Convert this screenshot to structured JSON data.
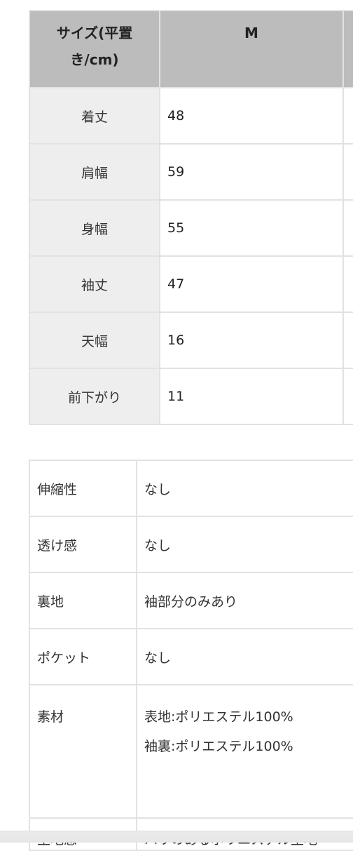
{
  "size_table": {
    "header": {
      "label": "サイズ(平置き/cm)",
      "label_line1": "サイズ(平置",
      "label_line2": "き/cm)",
      "size": "M"
    },
    "rows": [
      {
        "label": "着丈",
        "value": "48"
      },
      {
        "label": "肩幅",
        "value": "59"
      },
      {
        "label": "身幅",
        "value": "55"
      },
      {
        "label": "袖丈",
        "value": "47"
      },
      {
        "label": "天幅",
        "value": "16"
      },
      {
        "label": "前下がり",
        "value": "11"
      }
    ]
  },
  "spec_table": {
    "rows": [
      {
        "label": "伸縮性",
        "value": "なし"
      },
      {
        "label": "透け感",
        "value": "なし"
      },
      {
        "label": "裏地",
        "value": "袖部分のみあり"
      },
      {
        "label": "ポケット",
        "value": "なし"
      },
      {
        "label": "素材",
        "lines": [
          "表地:ポリエステル100%",
          "袖裏:ポリエステル100%"
        ]
      },
      {
        "label": "生地感",
        "value": "ハリのあるポリエステル生地"
      }
    ]
  },
  "colors": {
    "header_bg": "#bcbcbc",
    "label_bg": "#eeeeee",
    "border": "#e2e2e2"
  }
}
